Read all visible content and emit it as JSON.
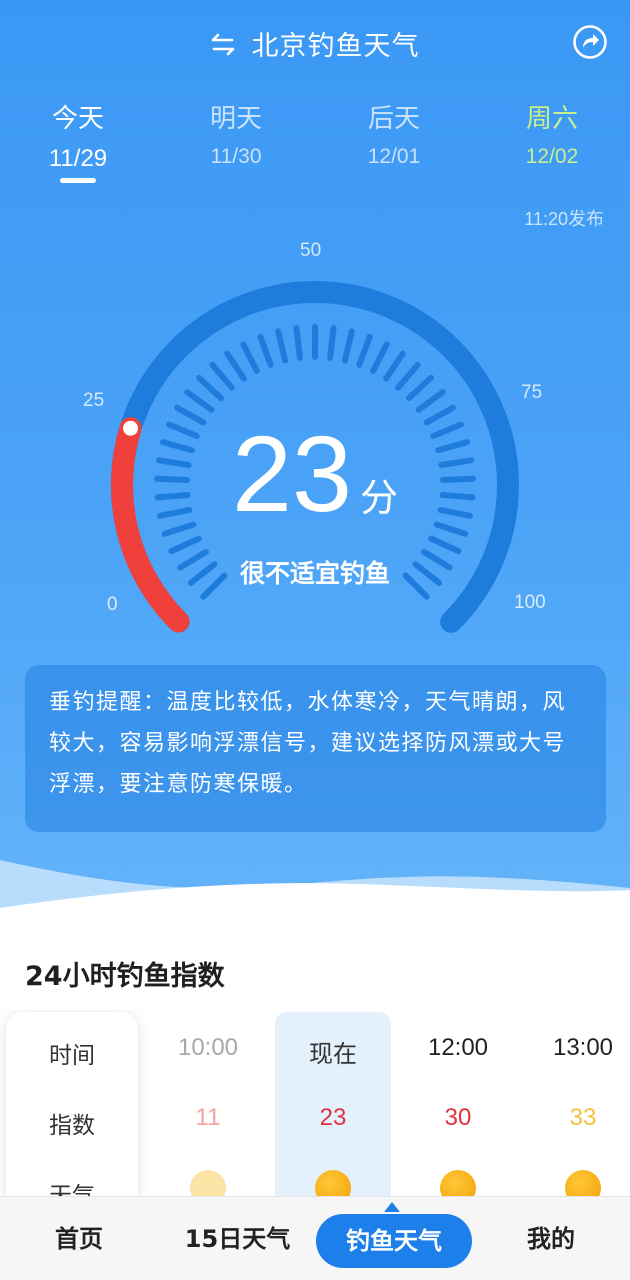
{
  "header": {
    "city_title": "北京钓鱼天气",
    "left_icon": "swap-icon",
    "right_icon": "share-icon"
  },
  "days": [
    {
      "name": "今天",
      "date": "11/29",
      "active": true
    },
    {
      "name": "明天",
      "date": "11/30"
    },
    {
      "name": "后天",
      "date": "12/01"
    },
    {
      "name": "周六",
      "date": "12/02",
      "weekend": true
    }
  ],
  "published": "11:20发布",
  "gauge": {
    "scale_labels": [
      "0",
      "25",
      "50",
      "75",
      "100"
    ],
    "score": "23",
    "score_unit": "分",
    "value": 23,
    "max": 100,
    "verdict": "很不适宜钓鱼"
  },
  "tips": {
    "text": "垂钓提醒：温度比较低，水体寒冷，天气晴朗，风较大，容易影响浮漂信号，建议选择防风漂或大号浮漂，要注意防寒保暖。"
  },
  "hourly": {
    "title": "24小时钓鱼指数",
    "row_labels": [
      "时间",
      "指数",
      "天气"
    ],
    "columns": [
      {
        "time": "10:00",
        "index": "11"
      },
      {
        "time": "现在",
        "index": "23"
      },
      {
        "time": "12:00",
        "index": "30"
      },
      {
        "time": "13:00",
        "index": "33"
      }
    ]
  },
  "nav": {
    "items": [
      "首页",
      "15日天气",
      "钓鱼天气",
      "我的"
    ],
    "active": "钓鱼天气"
  },
  "colors": {
    "primary": "#3A98F5",
    "accent": "#1D7FEA",
    "arc_red": "#F0403C",
    "weekend_green": "#C8EF8E",
    "sun": "#F7A90D"
  }
}
